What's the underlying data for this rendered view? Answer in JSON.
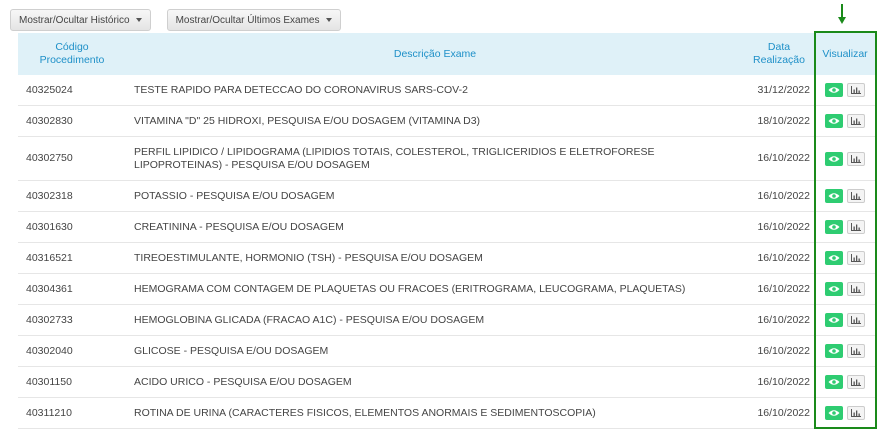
{
  "toolbar": {
    "history_label": "Mostrar/Ocultar Histórico",
    "last_exams_label": "Mostrar/Ocultar Últimos Exames"
  },
  "table": {
    "headers": {
      "code_line1": "Código",
      "code_line2": "Procedimento",
      "description": "Descrição Exame",
      "date_line1": "Data",
      "date_line2": "Realização",
      "view": "Visualizar"
    },
    "rows": [
      {
        "code": "40325024",
        "description": "TESTE RAPIDO PARA DETECCAO DO CORONAVIRUS SARS-COV-2",
        "date": "31/12/2022"
      },
      {
        "code": "40302830",
        "description": "VITAMINA \"D\" 25 HIDROXI, PESQUISA E/OU DOSAGEM (VITAMINA D3)",
        "date": "18/10/2022"
      },
      {
        "code": "40302750",
        "description": "PERFIL LIPIDICO / LIPIDOGRAMA (LIPIDIOS TOTAIS, COLESTEROL, TRIGLICERIDIOS E ELETROFORESE LIPOPROTEINAS) - PESQUISA E/OU DOSAGEM",
        "date": "16/10/2022"
      },
      {
        "code": "40302318",
        "description": "POTASSIO - PESQUISA E/OU DOSAGEM",
        "date": "16/10/2022"
      },
      {
        "code": "40301630",
        "description": "CREATININA - PESQUISA E/OU DOSAGEM",
        "date": "16/10/2022"
      },
      {
        "code": "40316521",
        "description": "TIREOESTIMULANTE, HORMONIO (TSH) - PESQUISA E/OU DOSAGEM",
        "date": "16/10/2022"
      },
      {
        "code": "40304361",
        "description": "HEMOGRAMA COM CONTAGEM DE PLAQUETAS OU FRACOES (ERITROGRAMA, LEUCOGRAMA, PLAQUETAS)",
        "date": "16/10/2022"
      },
      {
        "code": "40302733",
        "description": "HEMOGLOBINA GLICADA (FRACAO A1C) - PESQUISA E/OU DOSAGEM",
        "date": "16/10/2022"
      },
      {
        "code": "40302040",
        "description": "GLICOSE - PESQUISA E/OU DOSAGEM",
        "date": "16/10/2022"
      },
      {
        "code": "40301150",
        "description": "ACIDO URICO - PESQUISA E/OU DOSAGEM",
        "date": "16/10/2022"
      },
      {
        "code": "40311210",
        "description": "ROTINA DE URINA (CARACTERES FISICOS, ELEMENTOS ANORMAIS E SEDIMENTOSCOPIA)",
        "date": "16/10/2022"
      }
    ]
  },
  "icons": {
    "view": "eye-icon",
    "chart": "bar-chart-icon",
    "dropdown": "caret-down-icon",
    "indicator": "arrow-down-icon"
  },
  "colors": {
    "header_bg": "#dff1f8",
    "header_text": "#1e90c8",
    "view_button": "#2ecc71",
    "highlight": "#1a8a1a"
  }
}
